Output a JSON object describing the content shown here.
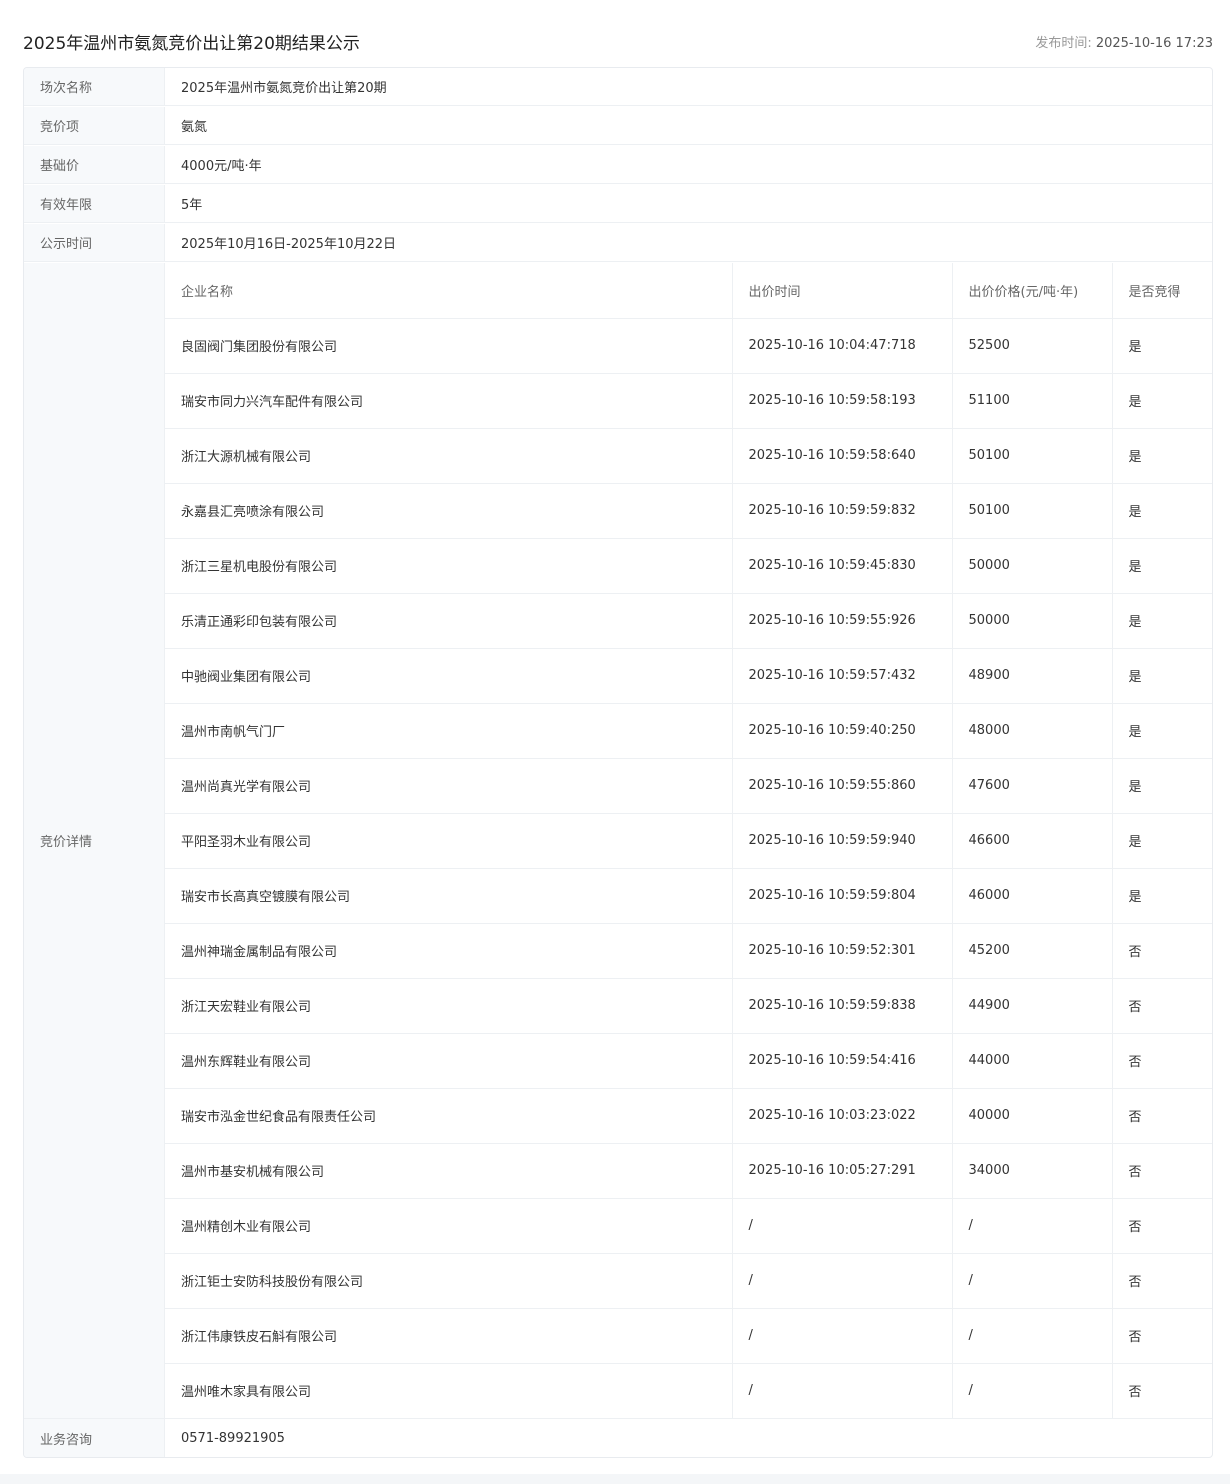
{
  "header": {
    "title": "2025年温州市氨氮竞价出让第20期结果公示",
    "publish_label": "发布时间: ",
    "publish_time": "2025-10-16 17:23"
  },
  "info": [
    {
      "label": "场次名称",
      "value": "2025年温州市氨氮竞价出让第20期"
    },
    {
      "label": "竞价项",
      "value": "氨氮"
    },
    {
      "label": "基础价",
      "value": "4000元/吨·年"
    },
    {
      "label": "有效年限",
      "value": "5年"
    },
    {
      "label": "公示时间",
      "value": "2025年10月16日-2025年10月22日"
    }
  ],
  "details": {
    "label": "竞价详情",
    "columns": {
      "company": "企业名称",
      "time": "出价时间",
      "price": "出价价格(元/吨·年)",
      "won": "是否竞得"
    },
    "rows": [
      {
        "company": "良固阀门集团股份有限公司",
        "time": "2025-10-16 10:04:47:718",
        "price": "52500",
        "won": "是"
      },
      {
        "company": "瑞安市同力兴汽车配件有限公司",
        "time": "2025-10-16 10:59:58:193",
        "price": "51100",
        "won": "是"
      },
      {
        "company": "浙江大源机械有限公司",
        "time": "2025-10-16 10:59:58:640",
        "price": "50100",
        "won": "是"
      },
      {
        "company": "永嘉县汇亮喷涂有限公司",
        "time": "2025-10-16 10:59:59:832",
        "price": "50100",
        "won": "是"
      },
      {
        "company": "浙江三星机电股份有限公司",
        "time": "2025-10-16 10:59:45:830",
        "price": "50000",
        "won": "是"
      },
      {
        "company": "乐清正通彩印包装有限公司",
        "time": "2025-10-16 10:59:55:926",
        "price": "50000",
        "won": "是"
      },
      {
        "company": "中驰阀业集团有限公司",
        "time": "2025-10-16 10:59:57:432",
        "price": "48900",
        "won": "是"
      },
      {
        "company": "温州市南帆气门厂",
        "time": "2025-10-16 10:59:40:250",
        "price": "48000",
        "won": "是"
      },
      {
        "company": "温州尚真光学有限公司",
        "time": "2025-10-16 10:59:55:860",
        "price": "47600",
        "won": "是"
      },
      {
        "company": "平阳圣羽木业有限公司",
        "time": "2025-10-16 10:59:59:940",
        "price": "46600",
        "won": "是"
      },
      {
        "company": "瑞安市长高真空镀膜有限公司",
        "time": "2025-10-16 10:59:59:804",
        "price": "46000",
        "won": "是"
      },
      {
        "company": "温州神瑞金属制品有限公司",
        "time": "2025-10-16 10:59:52:301",
        "price": "45200",
        "won": "否"
      },
      {
        "company": "浙江天宏鞋业有限公司",
        "time": "2025-10-16 10:59:59:838",
        "price": "44900",
        "won": "否"
      },
      {
        "company": "温州东辉鞋业有限公司",
        "time": "2025-10-16 10:59:54:416",
        "price": "44000",
        "won": "否"
      },
      {
        "company": "瑞安市泓金世纪食品有限责任公司",
        "time": "2025-10-16 10:03:23:022",
        "price": "40000",
        "won": "否"
      },
      {
        "company": "温州市基安机械有限公司",
        "time": "2025-10-16 10:05:27:291",
        "price": "34000",
        "won": "否"
      },
      {
        "company": "温州精创木业有限公司",
        "time": "/",
        "price": "/",
        "won": "否"
      },
      {
        "company": "浙江钜士安防科技股份有限公司",
        "time": "/",
        "price": "/",
        "won": "否"
      },
      {
        "company": "浙江伟康铁皮石斛有限公司",
        "time": "/",
        "price": "/",
        "won": "否"
      },
      {
        "company": "温州唯木家具有限公司",
        "time": "/",
        "price": "/",
        "won": "否"
      }
    ]
  },
  "contact": {
    "label": "业务咨询",
    "value": "0571-89921905"
  }
}
